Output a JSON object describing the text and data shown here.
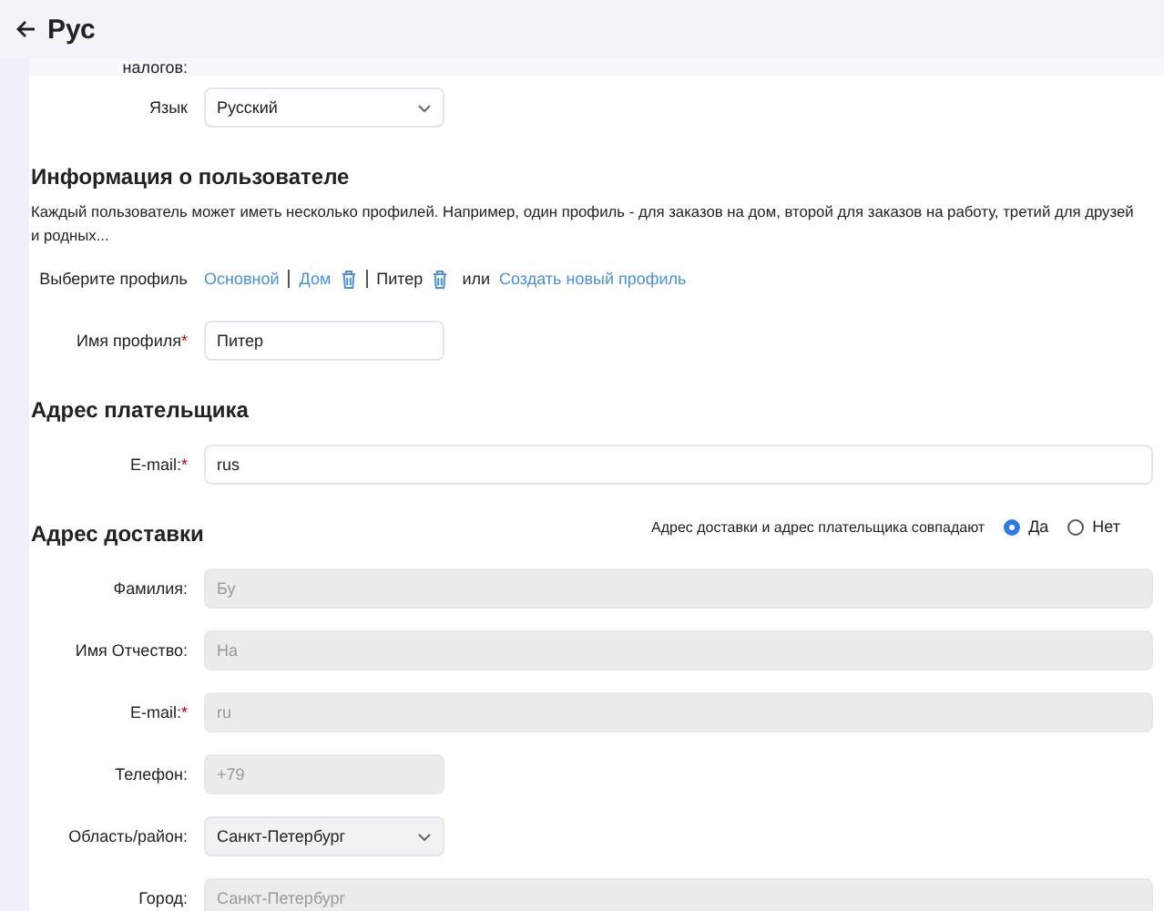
{
  "header": {
    "title": "Рус"
  },
  "tax_row": {
    "label": "налогов:"
  },
  "language": {
    "label": "Язык",
    "value": "Русский"
  },
  "user_info": {
    "heading": "Информация о пользователе",
    "description": "Каждый пользователь может иметь несколько профилей. Например, один профиль - для заказов на дом, второй для заказов на работу, третий для друзей и родных...",
    "profile_label": "Выберите профиль",
    "profiles": [
      {
        "label": "Основной",
        "selected": false,
        "deletable": false
      },
      {
        "label": "Дом",
        "selected": false,
        "deletable": true
      },
      {
        "label": "Питер",
        "selected": true,
        "deletable": true
      }
    ],
    "or": "или",
    "create_link": "Создать новый профиль",
    "name_field": {
      "label": "Имя профиля",
      "required_mark": "*",
      "value": "Питер"
    }
  },
  "payer": {
    "heading": "Адрес плательщика",
    "fields": [
      {
        "label": "E-mail:",
        "required_mark": "*",
        "value": "rus",
        "kind": "text",
        "wide": true,
        "disabled": false
      }
    ]
  },
  "delivery": {
    "heading": "Адрес доставки",
    "same_label": "Адрес доставки и адрес плательщика совпадают",
    "options": [
      {
        "label": "Да",
        "selected": true
      },
      {
        "label": "Нет",
        "selected": false
      }
    ],
    "fields": [
      {
        "label": "Фамилия:",
        "value": "Бу",
        "kind": "text",
        "wide": true,
        "disabled": true
      },
      {
        "label": "Имя Отчество:",
        "value": "На",
        "kind": "text",
        "wide": true,
        "disabled": true
      },
      {
        "label": "E-mail:",
        "required_mark": "*",
        "value": "ru",
        "kind": "text",
        "wide": true,
        "disabled": true
      },
      {
        "label": "Телефон:",
        "value": "+79",
        "kind": "text",
        "wide": false,
        "disabled": true
      },
      {
        "label": "Область/район:",
        "value": "Санкт-Петербург",
        "kind": "select",
        "wide": false,
        "disabled": false
      },
      {
        "label": "Город:",
        "value": "Санкт-Петербург",
        "kind": "text",
        "wide": true,
        "disabled": true
      }
    ]
  }
}
